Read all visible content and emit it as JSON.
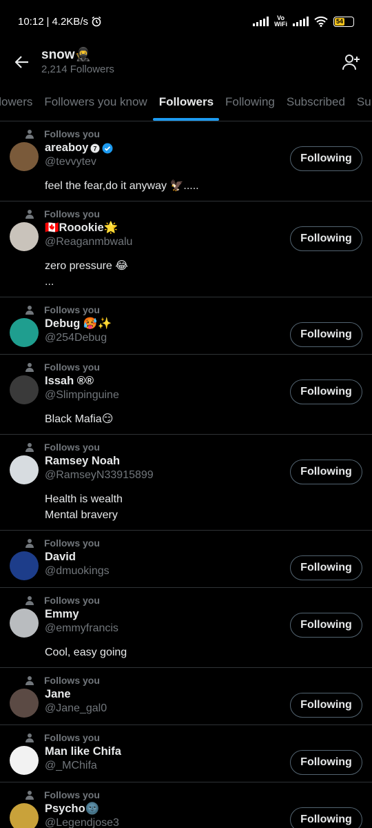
{
  "status": {
    "time": "10:12",
    "speed": "4.2KB/s",
    "vowifi_top": "Vo",
    "vowifi_bottom": "WiFi",
    "battery": "54"
  },
  "header": {
    "title": "snow🥷",
    "subtitle": "2,214 Followers"
  },
  "tabs": [
    {
      "label": "llowers"
    },
    {
      "label": "Followers you know"
    },
    {
      "label": "Followers"
    },
    {
      "label": "Following"
    },
    {
      "label": "Subscribed"
    },
    {
      "label": "Su"
    }
  ],
  "follows_label": "Follows you",
  "following_label": "Following",
  "users": [
    {
      "name": "areaboy",
      "handle": "@tevvytev",
      "bio": "feel the fear,do it anyway 🦅.....",
      "avatar_color": "#7a5a3a"
    },
    {
      "name": "🇨🇦Roookie🌟",
      "handle": "@Reaganmbwalu",
      "bio": "zero pressure 😂\n...",
      "avatar_color": "#c9c3bb"
    },
    {
      "name": "Debug 🥵✨",
      "handle": "@254Debug",
      "bio": "",
      "avatar_color": "#1f9e8f"
    },
    {
      "name": "Issah ®®",
      "handle": "@Slimpinguine",
      "bio": "Black Mafia😏",
      "avatar_color": "#3a3a3a"
    },
    {
      "name": "Ramsey Noah",
      "handle": "@RamseyN33915899",
      "bio": "Health is wealth\nMental bravery",
      "avatar_color": "#d7dce0"
    },
    {
      "name": "David",
      "handle": "@dmuokings",
      "bio": "",
      "avatar_color": "#1d3d8a"
    },
    {
      "name": "Emmy",
      "handle": "@emmyfrancis",
      "bio": "Cool, easy going",
      "avatar_color": "#b9bcbf"
    },
    {
      "name": "Jane",
      "handle": "@Jane_gal0",
      "bio": "",
      "avatar_color": "#5b4a44"
    },
    {
      "name": "Man like Chifa",
      "handle": "@_MChifa",
      "bio": "",
      "avatar_color": "#f2f2f2"
    },
    {
      "name": "Psycho🌚",
      "handle": "@Legendjose3",
      "bio": "",
      "avatar_color": "#c9a23a"
    }
  ]
}
